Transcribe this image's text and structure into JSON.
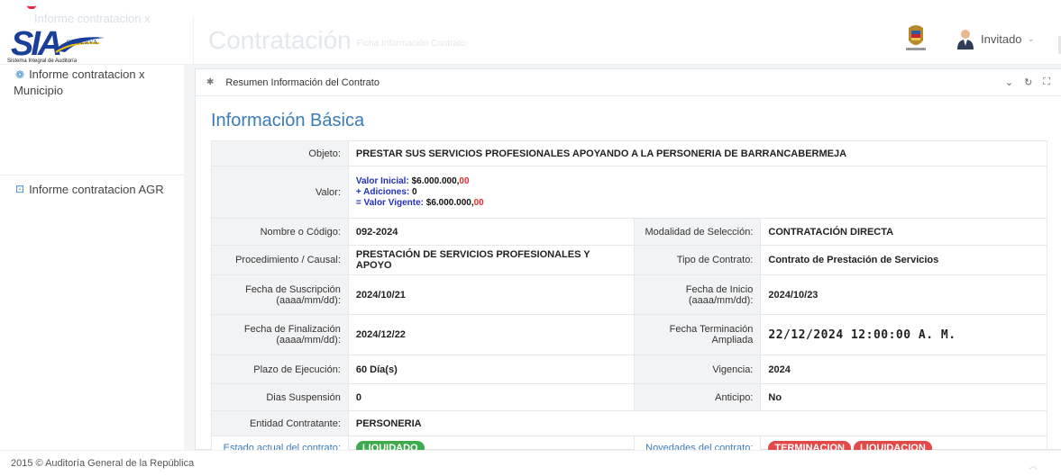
{
  "header": {
    "logo_text": "SIA",
    "logo_sub": "OBSERVA",
    "logo_caption": "Sistema Integral de Auditoría",
    "ghost_menu": "Informe contratacion x",
    "title": "Contratación",
    "subtitle": "Ficha Información Contrato",
    "user_label": "Invitado"
  },
  "sidebar": {
    "items": [
      {
        "label_line1": "Informe contratacion x",
        "label_line2": "Municipio",
        "icon": "sitemap-icon"
      },
      {
        "label": "Informe contratacion AGR",
        "icon": "inbox-icon"
      }
    ]
  },
  "panel": {
    "header_title": "Resumen Información del Contrato",
    "section_title": "Información Básica"
  },
  "contract": {
    "objeto_label": "Objeto:",
    "objeto": "PRESTAR SUS SERVICIOS PROFESIONALES APOYANDO A LA PERSONERIA DE BARRANCABERMEJA",
    "valor_label": "Valor:",
    "valor_inicial_label": "Valor Inicial:",
    "valor_inicial": "$6.000.000,",
    "valor_inicial_cents": "00",
    "adiciones_label": "+ Adiciones:",
    "adiciones": "0",
    "valor_vigente_label": "= Valor Vigente:",
    "valor_vigente": "$6.000.000,",
    "valor_vigente_cents": "00",
    "codigo_label": "Nombre o Código:",
    "codigo": "092-2024",
    "modalidad_label": "Modalidad de Selección:",
    "modalidad": "CONTRATACIÓN DIRECTA",
    "procedimiento_label": "Procedimiento / Causal:",
    "procedimiento": "PRESTACIÓN DE SERVICIOS PROFESIONALES Y APOYO",
    "tipo_label": "Tipo de Contrato:",
    "tipo": "Contrato de Prestación de Servicios",
    "suscripcion_label1": "Fecha de Suscripción",
    "suscripcion_label2": "(aaaa/mm/dd):",
    "suscripcion": "2024/10/21",
    "inicio_label1": "Fecha de Inicio",
    "inicio_label2": "(aaaa/mm/dd):",
    "inicio": "2024/10/23",
    "finalizacion_label1": "Fecha de Finalización",
    "finalizacion_label2": "(aaaa/mm/dd):",
    "finalizacion": "2024/12/22",
    "terminacion_label1": "Fecha Terminación",
    "terminacion_label2": "Ampliada",
    "terminacion": "22/12/2024 12:00:00 A. M.",
    "plazo_label": "Plazo de Ejecución:",
    "plazo": "60 Día(s)",
    "vigencia_label": "Vigencia:",
    "vigencia": "2024",
    "suspension_label": "Dias Suspensión",
    "suspension": "0",
    "anticipo_label": "Anticipo:",
    "anticipo": "No",
    "entidad_label": "Entidad Contratante:",
    "entidad": "PERSONERIA",
    "estado_label": "Estado actual del contrato:",
    "estado": "LIQUIDADO",
    "novedades_label": "Novedades del contrato:",
    "novedades": [
      "TERMINACION",
      "LIQUIDACION"
    ]
  },
  "footer": {
    "text": "2015 © Auditoría General de la República"
  },
  "colors": {
    "brand_blue": "#1a3f9a",
    "link_blue": "#3a7cb8",
    "status_green": "#3faa4d",
    "status_red": "#e24a4a"
  }
}
